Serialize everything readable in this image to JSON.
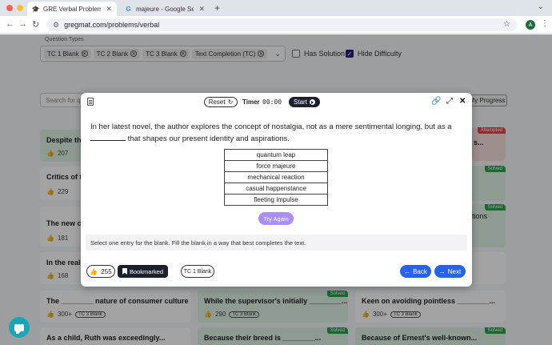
{
  "browser": {
    "tabs": [
      {
        "title": "GRE Verbal Problems - Gregm",
        "icon": "graduation-cap-icon",
        "active": true
      },
      {
        "title": "majeure - Google Search",
        "icon": "google-icon",
        "active": false
      }
    ],
    "url": "gregmat.com/problems/verbal",
    "avatar_letter": "A"
  },
  "filters": {
    "label": "Question Types",
    "chips": [
      "TC 1 Blank",
      "TC 2 Blank",
      "TC 3 Blank",
      "Text Completion (TC)"
    ],
    "has_solution": "Has Solution",
    "hide_difficulty": "Hide Difficulty",
    "search_placeholder": "Search for q",
    "my_progress": "My Progress"
  },
  "background_cards": [
    {
      "title": "Despite the",
      "count": "207",
      "tag": "",
      "color": "green"
    },
    {
      "title": "Critics of th",
      "count": "229",
      "tag": "",
      "color": "white"
    },
    {
      "title": "The new cu",
      "count": "181",
      "tag": "",
      "color": "white"
    },
    {
      "title": "In the realm",
      "count": "168",
      "tag": "",
      "color": "white"
    },
    {
      "title": "The ________ nature of consumer culture has...",
      "count": "300+",
      "pill": "TC 3 Blank",
      "tag": "",
      "color": "white"
    },
    {
      "title": "While the supervisor's initially ________...",
      "count": "290",
      "pill": "TC 3 Blank",
      "tag": "Solved",
      "color": "green"
    },
    {
      "title": "Keen on avoiding pointless ________...",
      "count": "300+",
      "pill": "TC 3 Blank",
      "tag": "",
      "color": "white"
    },
    {
      "title": "As a child, Ruth was exceedingly...",
      "tag": "",
      "color": "white"
    },
    {
      "title": "Because their breed is ________...",
      "tag": "Solved",
      "color": "green"
    },
    {
      "title": "Because of Ernest's well-known...",
      "tag": "Solved",
      "color": "green"
    },
    {
      "title": "s...",
      "tag": "Attempted",
      "color": "red"
    },
    {
      "title": "",
      "tag": "Solved",
      "color": "green"
    },
    {
      "title": "tions",
      "tag": "Solved",
      "color": "green"
    }
  ],
  "modal": {
    "reset_label": "Reset",
    "timer_label": "Timer",
    "timer_value": "00:00",
    "start_label": "Start",
    "question_before": "In her latest novel, the author explores the concept of nostalgia, not as a mere sentimental longing, but as a",
    "question_after": "that shapes our present identity and aspirations.",
    "options": [
      "quantum leap",
      "force majeure",
      "mechanical reaction",
      "casual happenstance",
      "fleeting impulse"
    ],
    "try_again": "Try Again",
    "instructions": "Select one entry for the blank. Fill the blank in a way that best completes the text.",
    "likes": "255",
    "bookmarked": "Bookmarked",
    "type_pill": "TC 1 Blank",
    "back": "Back",
    "next": "Next"
  },
  "colors": {
    "primary": "#2563eb",
    "dark": "#1b1f2e",
    "try_again": "#a98ff5",
    "solved": "#2e9e4e",
    "attempted": "#d94b4b",
    "chat": "#1aa5b8"
  }
}
